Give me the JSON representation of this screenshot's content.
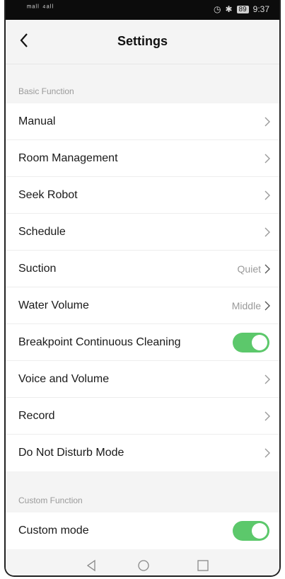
{
  "status_bar": {
    "signal_text": "ᵐᵃˡˡ ⁴ᵃˡˡ",
    "time": "9:37",
    "battery": "89"
  },
  "header": {
    "title": "Settings"
  },
  "sections": [
    {
      "label": "Basic Function",
      "rows": [
        {
          "label": "Manual",
          "value": "",
          "type": "link"
        },
        {
          "label": "Room Management",
          "value": "",
          "type": "link"
        },
        {
          "label": "Seek Robot",
          "value": "",
          "type": "link"
        },
        {
          "label": "Schedule",
          "value": "",
          "type": "link"
        },
        {
          "label": "Suction",
          "value": "Quiet",
          "type": "link"
        },
        {
          "label": "Water Volume",
          "value": "Middle",
          "type": "link"
        },
        {
          "label": "Breakpoint Continuous Cleaning",
          "value": "",
          "type": "toggle",
          "on": true
        },
        {
          "label": "Voice and Volume",
          "value": "",
          "type": "link"
        },
        {
          "label": "Record",
          "value": "",
          "type": "link"
        },
        {
          "label": "Do Not Disturb Mode",
          "value": "",
          "type": "link"
        }
      ]
    },
    {
      "label": "Custom Function",
      "rows": [
        {
          "label": "Custom mode",
          "value": "",
          "type": "toggle",
          "on": true
        }
      ]
    }
  ],
  "colors": {
    "toggle_on": "#5cc86b",
    "background": "#f4f4f4"
  }
}
